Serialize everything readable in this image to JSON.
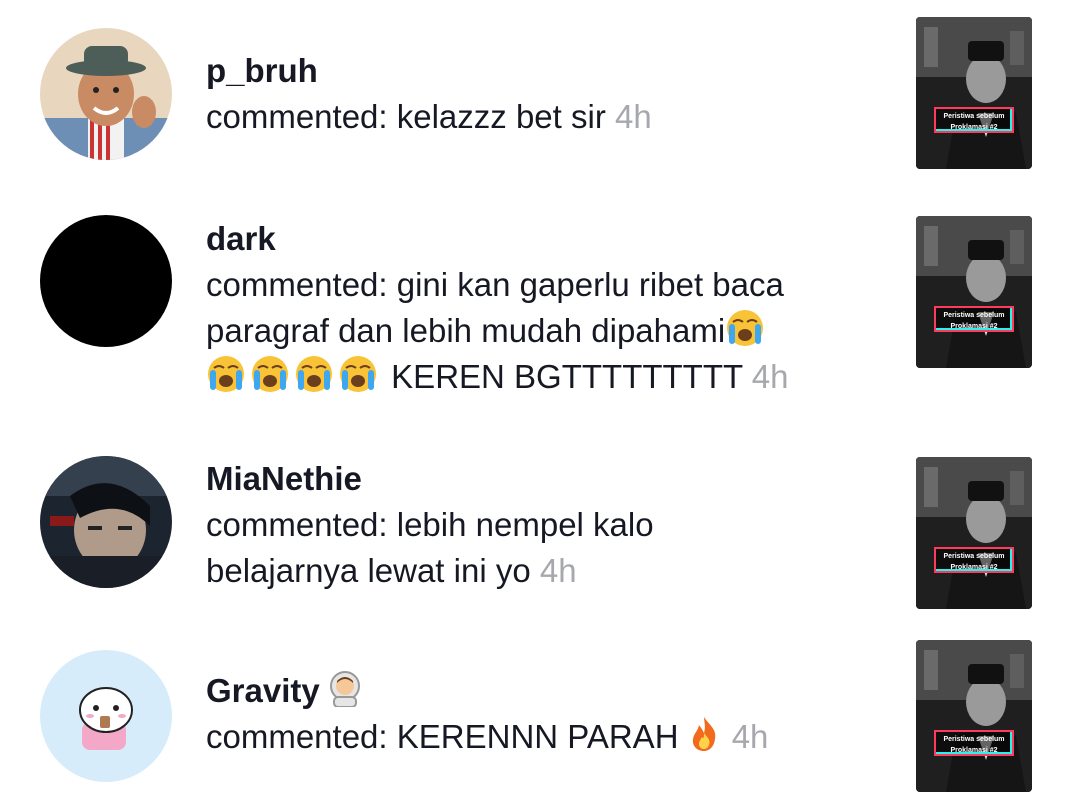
{
  "comments": [
    {
      "username": "p_bruh",
      "text": "commented: kelazzz bet sir",
      "time": "4h",
      "video_caption": [
        "Peristiwa sebelum",
        "Proklamasi #2"
      ]
    },
    {
      "username": "dark",
      "text": "commented: gini kan gaperlu ribet baca paragraf dan lebih mudah dipahami",
      "text_after_emojis": "KEREN BGTTTTTTTTT",
      "time": "4h",
      "video_caption": [
        "Peristiwa sebelum",
        "Proklamasi #2"
      ]
    },
    {
      "username": "MiaNethie",
      "text": "commented: lebih nempel kalo belajarnya lewat ini yo",
      "time": "4h",
      "video_caption": [
        "Peristiwa sebelum",
        "Proklamasi #2"
      ]
    },
    {
      "username": "Gravity",
      "username_emoji": "astronaut-emoji",
      "text": "commented: KERENNN PARAH",
      "text_emoji": "fire-emoji",
      "time": "4h",
      "video_caption": [
        "Peristiwa sebelum",
        "Proklamasi #2"
      ]
    }
  ],
  "colors": {
    "timestamp": "#a6a8ad",
    "text": "#161823",
    "caption_border": "#ff3b5c",
    "caption_accent": "#25f4ee"
  }
}
